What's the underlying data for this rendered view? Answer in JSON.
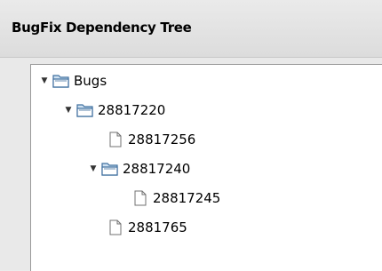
{
  "window": {
    "title": "BugFix Dependency Tree"
  },
  "tree": {
    "root": {
      "label": "Bugs",
      "type": "folder",
      "expanded": true,
      "icon": "folder-open-icon"
    },
    "n1": {
      "label": "28817220",
      "type": "folder",
      "expanded": true,
      "icon": "folder-open-icon"
    },
    "n2": {
      "label": "28817256",
      "type": "leaf",
      "icon": "file-icon"
    },
    "n3": {
      "label": "28817240",
      "type": "folder",
      "expanded": true,
      "icon": "folder-open-icon"
    },
    "n4": {
      "label": "28817245",
      "type": "leaf",
      "icon": "file-icon"
    },
    "n5": {
      "label": "2881765",
      "type": "leaf",
      "icon": "file-icon"
    }
  },
  "colors": {
    "folder": "#3f6f9f",
    "folder_fill": "#cfe1f1",
    "file_fill": "#ffffff",
    "file_stroke": "#707070"
  }
}
